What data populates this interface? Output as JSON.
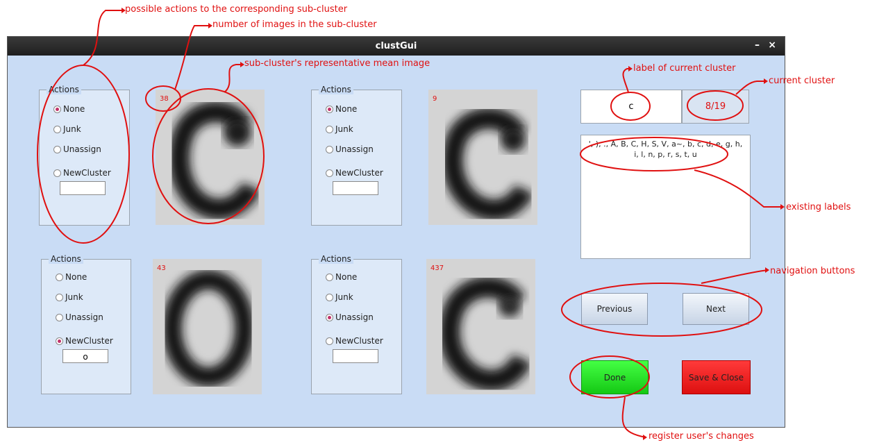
{
  "window": {
    "title": "clustGui",
    "minimize": "–",
    "close": "×"
  },
  "subclusters": [
    {
      "actions_legend": "Actions",
      "count": "38",
      "options": [
        "None",
        "Junk",
        "Unassign",
        "NewCluster"
      ],
      "selected": "None",
      "new_cluster_value": ""
    },
    {
      "actions_legend": "Actions",
      "count": "9",
      "options": [
        "None",
        "Junk",
        "Unassign",
        "NewCluster"
      ],
      "selected": "None",
      "new_cluster_value": ""
    },
    {
      "actions_legend": "Actions",
      "count": "43",
      "options": [
        "None",
        "Junk",
        "Unassign",
        "NewCluster"
      ],
      "selected": "NewCluster",
      "new_cluster_value": "o"
    },
    {
      "actions_legend": "Actions",
      "count": "437",
      "options": [
        "None",
        "Junk",
        "Unassign",
        "NewCluster"
      ],
      "selected": "Unassign",
      "new_cluster_value": ""
    }
  ],
  "current_cluster": {
    "label": "c",
    "position": "8/19"
  },
  "existing_labels": "', ), ., A, B, C, H, S, V, a~, b, c, d, e, g, h, i, l, n, p, r, s, t, u",
  "buttons": {
    "previous": "Previous",
    "next": "Next",
    "done": "Done",
    "save_close": "Save & Close"
  },
  "colors": {
    "done": "#22e022",
    "save_close": "#ee1a1a",
    "annotation": "#e01010",
    "window_bg": "#c9dcf5"
  },
  "annotations": {
    "actions": "possible actions to the corresponding sub-cluster",
    "count": "number of images in the sub-cluster",
    "mean_image": "sub-cluster's representative mean image",
    "label": "label of current cluster",
    "current": "current cluster",
    "existing": "existing labels",
    "navigation": "navigation buttons",
    "register": "register user's changes"
  }
}
